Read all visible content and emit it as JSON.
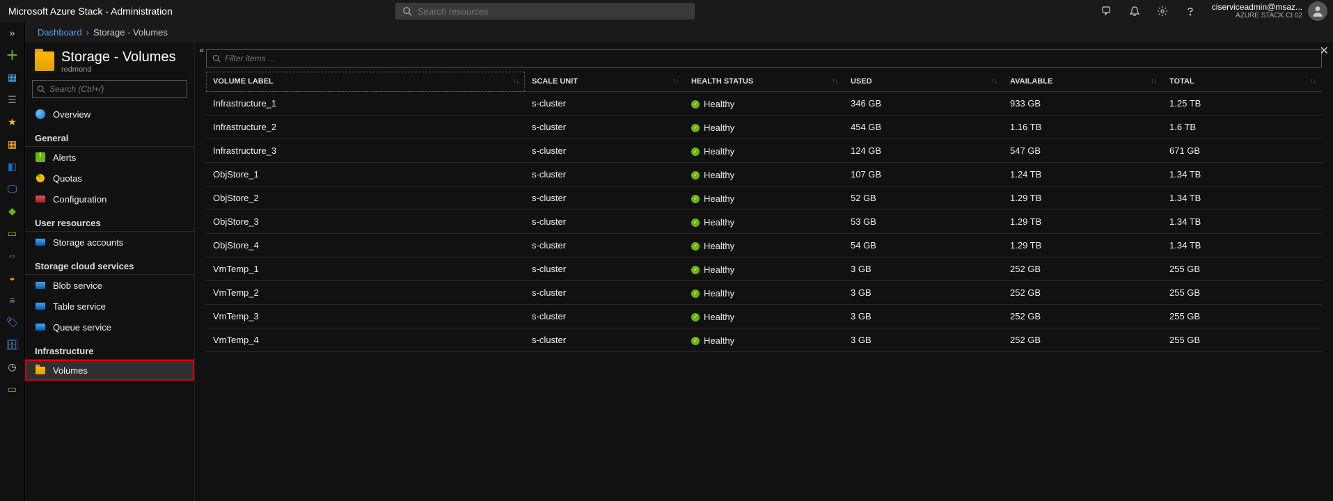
{
  "topbar": {
    "brand": "Microsoft Azure Stack - Administration",
    "search_placeholder": "Search resources",
    "account_email": "ciserviceadmin@msaz...",
    "account_org": "AZURE STACK CI 02"
  },
  "breadcrumb": {
    "root": "Dashboard",
    "current": "Storage - Volumes"
  },
  "blade": {
    "title": "Storage - Volumes",
    "subtitle": "redmond",
    "search_placeholder": "Search (Ctrl+/)",
    "collapse_glyph": "«",
    "close_glyph": "✕"
  },
  "nav": {
    "overview": "Overview",
    "sections": {
      "general": "General",
      "user_resources": "User resources",
      "storage_cloud": "Storage cloud services",
      "infrastructure": "Infrastructure"
    },
    "items": {
      "alerts": "Alerts",
      "quotas": "Quotas",
      "configuration": "Configuration",
      "storage_accounts": "Storage accounts",
      "blob_service": "Blob service",
      "table_service": "Table service",
      "queue_service": "Queue service",
      "volumes": "Volumes"
    }
  },
  "grid": {
    "filter_placeholder": "Filter items ...",
    "headers": {
      "volume_label": "VOLUME LABEL",
      "scale_unit": "SCALE UNIT",
      "health_status": "HEALTH STATUS",
      "used": "USED",
      "available": "AVAILABLE",
      "total": "TOTAL"
    },
    "rows": [
      {
        "label": "Infrastructure_1",
        "scale": "s-cluster",
        "health": "Healthy",
        "used": "346 GB",
        "avail": "933 GB",
        "total": "1.25 TB"
      },
      {
        "label": "Infrastructure_2",
        "scale": "s-cluster",
        "health": "Healthy",
        "used": "454 GB",
        "avail": "1.16 TB",
        "total": "1.6 TB"
      },
      {
        "label": "Infrastructure_3",
        "scale": "s-cluster",
        "health": "Healthy",
        "used": "124 GB",
        "avail": "547 GB",
        "total": "671 GB"
      },
      {
        "label": "ObjStore_1",
        "scale": "s-cluster",
        "health": "Healthy",
        "used": "107 GB",
        "avail": "1.24 TB",
        "total": "1.34 TB"
      },
      {
        "label": "ObjStore_2",
        "scale": "s-cluster",
        "health": "Healthy",
        "used": "52 GB",
        "avail": "1.29 TB",
        "total": "1.34 TB"
      },
      {
        "label": "ObjStore_3",
        "scale": "s-cluster",
        "health": "Healthy",
        "used": "53 GB",
        "avail": "1.29 TB",
        "total": "1.34 TB"
      },
      {
        "label": "ObjStore_4",
        "scale": "s-cluster",
        "health": "Healthy",
        "used": "54 GB",
        "avail": "1.29 TB",
        "total": "1.34 TB"
      },
      {
        "label": "VmTemp_1",
        "scale": "s-cluster",
        "health": "Healthy",
        "used": "3 GB",
        "avail": "252 GB",
        "total": "255 GB"
      },
      {
        "label": "VmTemp_2",
        "scale": "s-cluster",
        "health": "Healthy",
        "used": "3 GB",
        "avail": "252 GB",
        "total": "255 GB"
      },
      {
        "label": "VmTemp_3",
        "scale": "s-cluster",
        "health": "Healthy",
        "used": "3 GB",
        "avail": "252 GB",
        "total": "255 GB"
      },
      {
        "label": "VmTemp_4",
        "scale": "s-cluster",
        "health": "Healthy",
        "used": "3 GB",
        "avail": "252 GB",
        "total": "255 GB"
      }
    ]
  }
}
